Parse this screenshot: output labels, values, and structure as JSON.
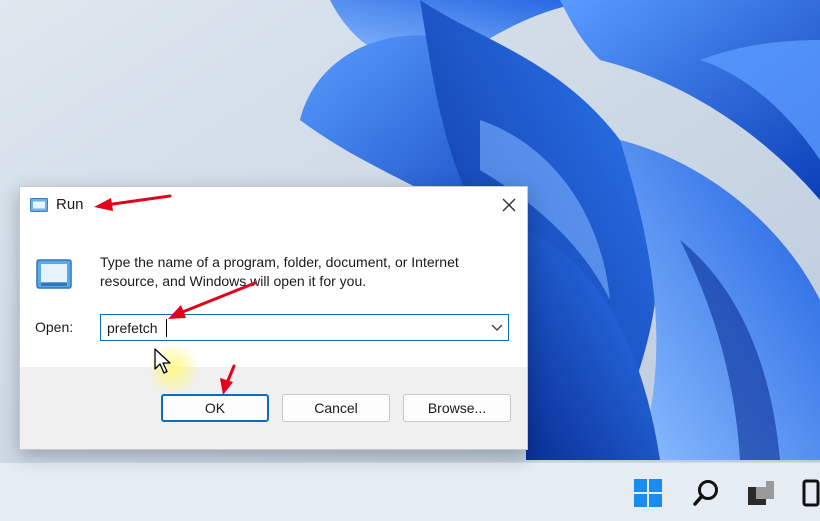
{
  "dialog": {
    "title": "Run",
    "description": "Type the name of a program, folder, document, or Internet resource, and Windows will open it for you.",
    "open_label": "Open:",
    "open_value": "prefetch",
    "buttons": {
      "ok": "OK",
      "cancel": "Cancel",
      "browse": "Browse..."
    }
  },
  "taskbar": {
    "icons": [
      "windows-start-icon",
      "search-icon",
      "task-view-icon",
      "widgets-icon"
    ]
  },
  "annotations": {
    "arrow_color": "#e3001b",
    "arrow_count": 3
  },
  "colors": {
    "accent": "#0f6cbd",
    "wallpaper_blue": "#1e63e0"
  }
}
